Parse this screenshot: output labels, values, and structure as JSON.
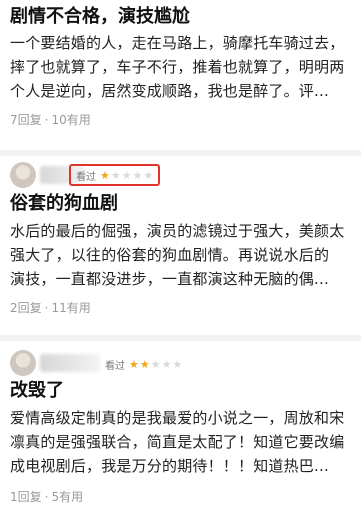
{
  "reviews": [
    {
      "title": "剧情不合格，演技尴尬",
      "lines": [
        "一个要结婚的人，走在马路上，骑摩托车骑过去，",
        "摔了也就算了，车子不行，推着也就算了，明明两",
        "个人是逆向，居然变成顺路，我也是醉了。评..."
      ],
      "replies": "7回复",
      "helpful": "10有用"
    },
    {
      "watched_label": "看过",
      "stars": 1,
      "max_stars": 5,
      "title": "俗套的狗血剧",
      "lines": [
        "水后的最后的倔强，演员的滤镜过于强大，美颜太",
        "强大了，以往的俗套的狗血剧情。再说说水后的",
        "演技，一直都没进步，一直都演这种无脑的偶..."
      ],
      "replies": "2回复",
      "helpful": "11有用"
    },
    {
      "watched_label": "看过",
      "stars": 2,
      "max_stars": 5,
      "title": "改毁了",
      "lines": [
        "爱情高级定制真的是我最爱的小说之一，周放和宋",
        "凛真的是强强联合，简直是太配了！知道它要改编",
        "成电视剧后，我是万分的期待！！！知道热巴..."
      ],
      "replies": "1回复",
      "helpful": "5有用"
    }
  ],
  "meta_separator": "·",
  "colors": {
    "star_on": "#f2a516",
    "star_off": "#d9d9d9",
    "highlight_box": "#e0332f",
    "meta_text": "#9a9a9a"
  },
  "icons": {
    "star": "star-icon"
  }
}
